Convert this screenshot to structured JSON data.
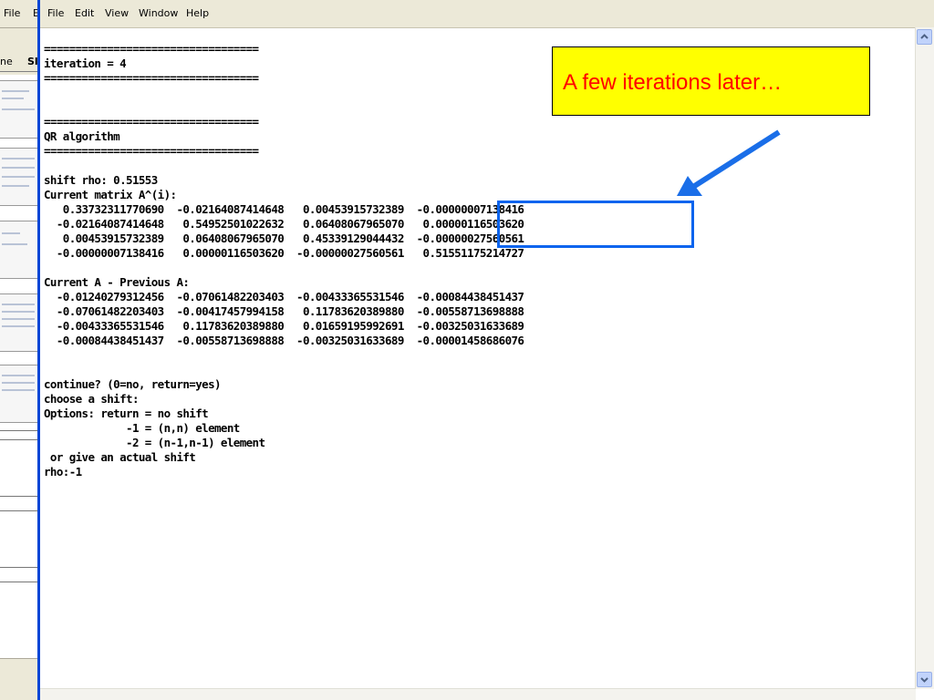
{
  "background_window": {
    "menu": [
      "File",
      "E"
    ],
    "tabs": [
      "ne",
      "Sl"
    ]
  },
  "menubar": {
    "items": [
      "File",
      "Edit",
      "View",
      "Window",
      "Help"
    ]
  },
  "console": {
    "lines": [
      "==================================",
      "iteration = 4",
      "==================================",
      "",
      "",
      "==================================",
      "QR algorithm",
      "==================================",
      "",
      "shift rho: 0.51553",
      "Current matrix A^(i):",
      "   0.33732311770690  -0.02164087414648   0.00453915732389  -0.00000007138416",
      "  -0.02164087414648   0.54952501022632   0.06408067965070   0.00000116503620",
      "   0.00453915732389   0.06408067965070   0.45339129044432  -0.00000027560561",
      "  -0.00000007138416   0.00000116503620  -0.00000027560561   0.51551175214727",
      "",
      "Current A - Previous A:",
      "  -0.01240279312456  -0.07061482203403  -0.00433365531546  -0.00084438451437",
      "  -0.07061482203403  -0.00417457994158   0.11783620389880  -0.00558713698888",
      "  -0.00433365531546   0.11783620389880   0.01659195992691  -0.00325031633689",
      "  -0.00084438451437  -0.00558713698888  -0.00325031633689  -0.00001458686076",
      "",
      "",
      "continue? (0=no, return=yes)",
      "choose a shift:",
      "Options: return = no shift",
      "             -1 = (n,n) element",
      "             -2 = (n-1,n-1) element",
      " or give an actual shift",
      "rho:-1"
    ]
  },
  "callout": {
    "text": "A few iterations later…",
    "background": "#ffff00",
    "text_color": "#ff0000"
  },
  "annotation": {
    "box_color": "#0a64ee",
    "arrow_color": "#1a6ee8"
  }
}
